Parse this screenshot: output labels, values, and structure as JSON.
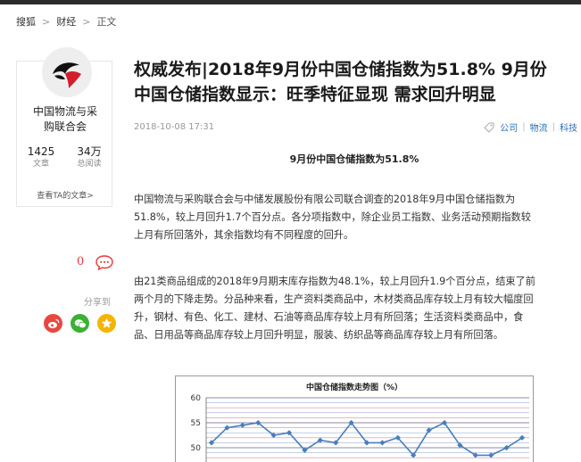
{
  "breadcrumb": {
    "items": [
      "搜狐",
      "财经",
      "正文"
    ]
  },
  "author": {
    "name_line1": "中国物流与采",
    "name_line2": "购联合会",
    "articles_count": "1425",
    "articles_label": "文章",
    "views_count": "34万",
    "views_label": "总阅读",
    "see_articles": "查看TA的文章>"
  },
  "interactions": {
    "comment_count": "0",
    "share_label": "分享到"
  },
  "share_buttons": [
    {
      "name": "weibo",
      "color": "#e6483f"
    },
    {
      "name": "wechat",
      "color": "#3cb034"
    },
    {
      "name": "qzone",
      "color": "#f5b400"
    }
  ],
  "article": {
    "title_line1": "权威发布|2018年9月份中国仓储指数为51.8% 9月份",
    "title_line2": "中国仓储指数显示：旺季特征显现 需求回升明显",
    "time": "2018-10-08 17:31",
    "tags": [
      "公司",
      "物流",
      "科技"
    ],
    "subhead": "9月份中国仓储指数为51.8%",
    "para1_lines": [
      "中国物流与采购联合会与中储发展股份有限公司联合调查的2018年9月中国仓储指数为",
      "51.8%，较上月回升1.7个百分点。各分项指数中，除企业员工指数、业务活动预期指数较",
      "上月有所回落外，其余指数均有不同程度的回升。"
    ],
    "para2_lines": [
      "由21类商品组成的2018年9月期末库存指数为48.1%，较上月回升1.9个百分点，结束了前",
      "两个月的下降走势。分品种来看，生产资料类商品中，木材类商品库存较上月有较大幅度回",
      "升，钢材、有色、化工、建材、石油等商品库存较上月有所回落；生活资料类商品中，食",
      "品、日用品等商品库存较上月回升明显，服装、纺织品等商品库存较上月有所回落。"
    ]
  },
  "colors": {
    "accent_red": "#e4393c",
    "link_blue": "#2a6fb5",
    "chart_line": "#4a7ebb"
  },
  "chart_data": {
    "type": "line",
    "title": "中国仓储指数走势图（%）",
    "ylim": [
      45,
      60
    ],
    "yticks": [
      50,
      55,
      60
    ],
    "series": [
      {
        "values": [
          51,
          54,
          54.5,
          55,
          52.5,
          53,
          49.5,
          51.5,
          51,
          55,
          51,
          51,
          52,
          48.5,
          53.5,
          55,
          50.5,
          48.5,
          48.5,
          50,
          52
        ]
      }
    ],
    "grid": true
  }
}
